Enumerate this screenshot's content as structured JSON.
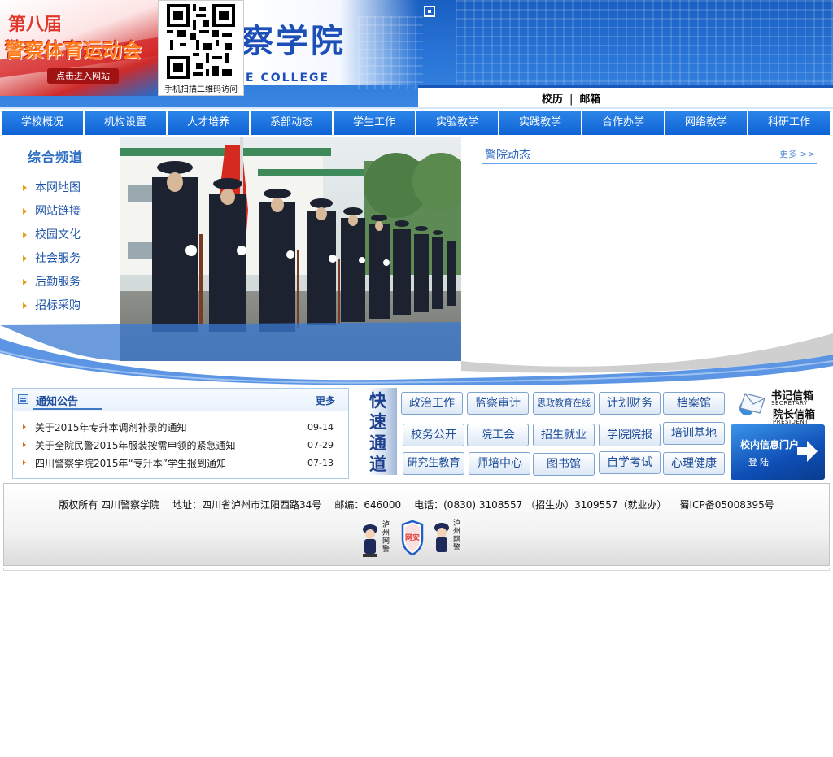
{
  "header": {
    "college_name_cn": "察学院",
    "college_name_en": "E COLLEGE",
    "games_banner": {
      "line1": "第八届",
      "line2": "警察体育运动会",
      "enter_label": "点击进入网站"
    },
    "qr_caption": "手机扫描二维码访问",
    "top_links": [
      "校历",
      "邮箱"
    ]
  },
  "main_nav": [
    "学校概况",
    "机构设置",
    "人才培养",
    "系部动态",
    "学生工作",
    "实验教学",
    "实践教学",
    "合作办学",
    "网络教学",
    "科研工作"
  ],
  "channel": {
    "title": "综合频道",
    "items": [
      "本网地图",
      "网站链接",
      "校园文化",
      "社会服务",
      "后勤服务",
      "招标采购"
    ]
  },
  "police_news": {
    "title": "警院动态",
    "more": "更多 >>"
  },
  "notice": {
    "title": "通知公告",
    "more": "更多",
    "items": [
      {
        "title": "关于2015年专升本调剂补录的通知",
        "date": "09-14"
      },
      {
        "title": "关于全院民警2015年服装按需申领的紧急通知",
        "date": "07-29"
      },
      {
        "title": "四川警察学院2015年“专升本”学生报到通知",
        "date": "07-13"
      }
    ]
  },
  "quick": {
    "label_chars": [
      "快",
      "速",
      "通",
      "道"
    ],
    "rows": [
      [
        "政治工作",
        "监察审计",
        "思政教育在线",
        "计划财务",
        "档案馆"
      ],
      [
        "校务公开",
        "院工会",
        "招生就业",
        "学院院报",
        "培训基地"
      ],
      [
        "研究生教育",
        "师培中心",
        "图书馆",
        "自学考试",
        "心理健康"
      ]
    ]
  },
  "mailbox": {
    "secretary_cn": "书记信箱",
    "secretary_en": "SECRETARY",
    "president_cn": "院长信箱",
    "president_en": "PRESIDENT"
  },
  "portal": {
    "line1": "校内信息门户",
    "line2": "登陆"
  },
  "footer": {
    "copyright": "版权所有  四川警察学院",
    "address": "地址：四川省泸州市江阳西路34号",
    "postcode": "邮编：646000",
    "phone": "电话：(0830) 3108557 （招生办）3109557（就业办）",
    "icp": "蜀ICP备05008395号",
    "badge_left": "泸州网警",
    "badge_mid": "网安",
    "badge_right": "泸州网警"
  },
  "colors": {
    "nav_blue": "#0f63d4",
    "header_blue": "#1a5fc2",
    "link_blue": "#1e54a8"
  }
}
